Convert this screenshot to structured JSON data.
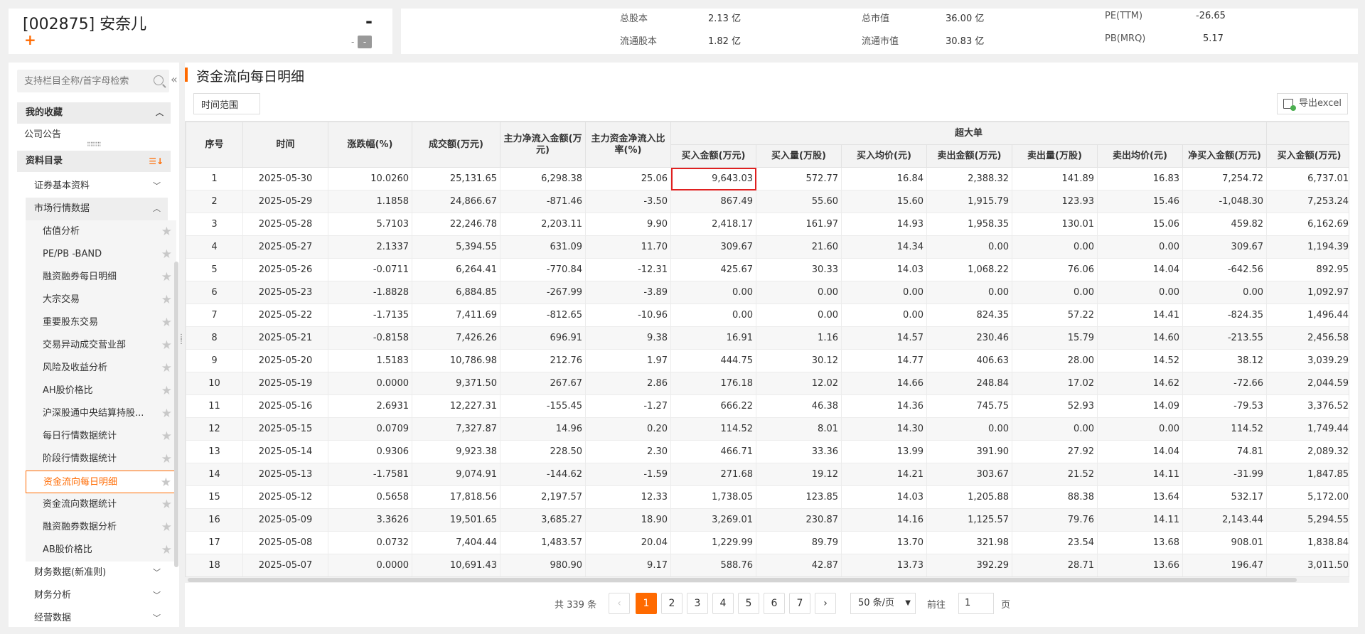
{
  "stock": {
    "title": "[002875] 安奈儿",
    "price": "-",
    "change": "-",
    "change_box": "-"
  },
  "stats": [
    {
      "label": "总股本",
      "value": "2.13 亿"
    },
    {
      "label": "总市值",
      "value": "36.00 亿"
    },
    {
      "label": "PE(TTM)",
      "value": "-26.65"
    },
    {
      "label": "流通股本",
      "value": "1.82 亿"
    },
    {
      "label": "流通市值",
      "value": "30.83 亿"
    },
    {
      "label": "PB(MRQ)",
      "value": "5.17"
    }
  ],
  "sidebar": {
    "search_placeholder": "支持栏目全称/首字母检索",
    "favorites_header": "我的收藏",
    "favorites": [
      "公司公告"
    ],
    "catalog_header": "资料目录",
    "sections": {
      "basic": "证券基本资料",
      "market": "市场行情数据",
      "finance_new": "财务数据(新准则)",
      "finance_analysis": "财务分析",
      "operation": "经营数据"
    },
    "market_items": [
      "估值分析",
      "PE/PB -BAND",
      "融资融券每日明细",
      "大宗交易",
      "重要股东交易",
      "交易异动成交营业部",
      "风险及收益分析",
      "AH股价格比",
      "沪深股通中央结算持股...",
      "每日行情数据统计",
      "阶段行情数据统计",
      "资金流向每日明细",
      "资金流向数据统计",
      "融资融券数据分析",
      "AB股价格比"
    ]
  },
  "main": {
    "title": "资金流向每日明细",
    "range_button": "时间范围",
    "export_button": "导出excel",
    "group_header": "超大单",
    "columns": [
      "序号",
      "时间",
      "涨跌幅(%)",
      "成交额(万元)",
      "主力净流入金额(万元)",
      "主力资金净流入比率(%)"
    ],
    "sub_columns": [
      "买入金额(万元)",
      "买入量(万股)",
      "买入均价(元)",
      "卖出金额(万元)",
      "卖出量(万股)",
      "卖出均价(元)",
      "净买入金额(万元)",
      "买入金额(万元)"
    ],
    "rows": [
      [
        "1",
        "2025-05-30",
        "10.0260",
        "25,131.65",
        "6,298.38",
        "25.06",
        "9,643.03",
        "572.77",
        "16.84",
        "2,388.32",
        "141.89",
        "16.83",
        "7,254.72",
        "6,737.01"
      ],
      [
        "2",
        "2025-05-29",
        "1.1858",
        "24,866.67",
        "-871.46",
        "-3.50",
        "867.49",
        "55.60",
        "15.60",
        "1,915.79",
        "123.93",
        "15.46",
        "-1,048.30",
        "7,253.24"
      ],
      [
        "3",
        "2025-05-28",
        "5.7103",
        "22,246.78",
        "2,203.11",
        "9.90",
        "2,418.17",
        "161.97",
        "14.93",
        "1,958.35",
        "130.01",
        "15.06",
        "459.82",
        "6,162.69"
      ],
      [
        "4",
        "2025-05-27",
        "2.1337",
        "5,394.55",
        "631.09",
        "11.70",
        "309.67",
        "21.60",
        "14.34",
        "0.00",
        "0.00",
        "0.00",
        "309.67",
        "1,194.39"
      ],
      [
        "5",
        "2025-05-26",
        "-0.0711",
        "6,264.41",
        "-770.84",
        "-12.31",
        "425.67",
        "30.33",
        "14.03",
        "1,068.22",
        "76.06",
        "14.04",
        "-642.56",
        "892.95"
      ],
      [
        "6",
        "2025-05-23",
        "-1.8828",
        "6,884.85",
        "-267.99",
        "-3.89",
        "0.00",
        "0.00",
        "0.00",
        "0.00",
        "0.00",
        "0.00",
        "0.00",
        "1,092.97"
      ],
      [
        "7",
        "2025-05-22",
        "-1.7135",
        "7,411.69",
        "-812.65",
        "-10.96",
        "0.00",
        "0.00",
        "0.00",
        "824.35",
        "57.22",
        "14.41",
        "-824.35",
        "1,496.44"
      ],
      [
        "8",
        "2025-05-21",
        "-0.8158",
        "7,426.26",
        "696.91",
        "9.38",
        "16.91",
        "1.16",
        "14.57",
        "230.46",
        "15.79",
        "14.60",
        "-213.55",
        "2,456.58"
      ],
      [
        "9",
        "2025-05-20",
        "1.5183",
        "10,786.98",
        "212.76",
        "1.97",
        "444.75",
        "30.12",
        "14.77",
        "406.63",
        "28.00",
        "14.52",
        "38.12",
        "3,039.29"
      ],
      [
        "10",
        "2025-05-19",
        "0.0000",
        "9,371.50",
        "267.67",
        "2.86",
        "176.18",
        "12.02",
        "14.66",
        "248.84",
        "17.02",
        "14.62",
        "-72.66",
        "2,044.59"
      ],
      [
        "11",
        "2025-05-16",
        "2.6931",
        "12,227.31",
        "-155.45",
        "-1.27",
        "666.22",
        "46.38",
        "14.36",
        "745.75",
        "52.93",
        "14.09",
        "-79.53",
        "3,376.52"
      ],
      [
        "12",
        "2025-05-15",
        "0.0709",
        "7,327.87",
        "14.96",
        "0.20",
        "114.52",
        "8.01",
        "14.30",
        "0.00",
        "0.00",
        "0.00",
        "114.52",
        "1,749.44"
      ],
      [
        "13",
        "2025-05-14",
        "0.9306",
        "9,923.38",
        "228.50",
        "2.30",
        "466.71",
        "33.36",
        "13.99",
        "391.90",
        "27.92",
        "14.04",
        "74.81",
        "2,089.32"
      ],
      [
        "14",
        "2025-05-13",
        "-1.7581",
        "9,074.91",
        "-144.62",
        "-1.59",
        "271.68",
        "19.12",
        "14.21",
        "303.67",
        "21.52",
        "14.11",
        "-31.99",
        "1,847.85"
      ],
      [
        "15",
        "2025-05-12",
        "0.5658",
        "17,818.56",
        "2,197.57",
        "12.33",
        "1,738.05",
        "123.85",
        "14.03",
        "1,205.88",
        "88.38",
        "13.64",
        "532.17",
        "5,172.00"
      ],
      [
        "16",
        "2025-05-09",
        "3.3626",
        "19,501.65",
        "3,685.27",
        "18.90",
        "3,269.01",
        "230.87",
        "14.16",
        "1,125.57",
        "79.76",
        "14.11",
        "2,143.44",
        "5,294.55"
      ],
      [
        "17",
        "2025-05-08",
        "0.0732",
        "7,404.44",
        "1,483.57",
        "20.04",
        "1,229.99",
        "89.79",
        "13.70",
        "321.98",
        "23.54",
        "13.68",
        "908.01",
        "1,838.84"
      ],
      [
        "18",
        "2025-05-07",
        "0.0000",
        "10,691.43",
        "980.90",
        "9.17",
        "588.76",
        "42.87",
        "13.73",
        "392.29",
        "28.71",
        "13.66",
        "196.47",
        "3,011.50"
      ]
    ]
  },
  "pager": {
    "total": "共 339 条",
    "prev": "‹",
    "next": "›",
    "pages": [
      "1",
      "2",
      "3",
      "4",
      "5",
      "6",
      "7"
    ],
    "page_size": "50 条/页",
    "goto_label": "前往",
    "goto_value": "1",
    "goto_unit": "页"
  }
}
